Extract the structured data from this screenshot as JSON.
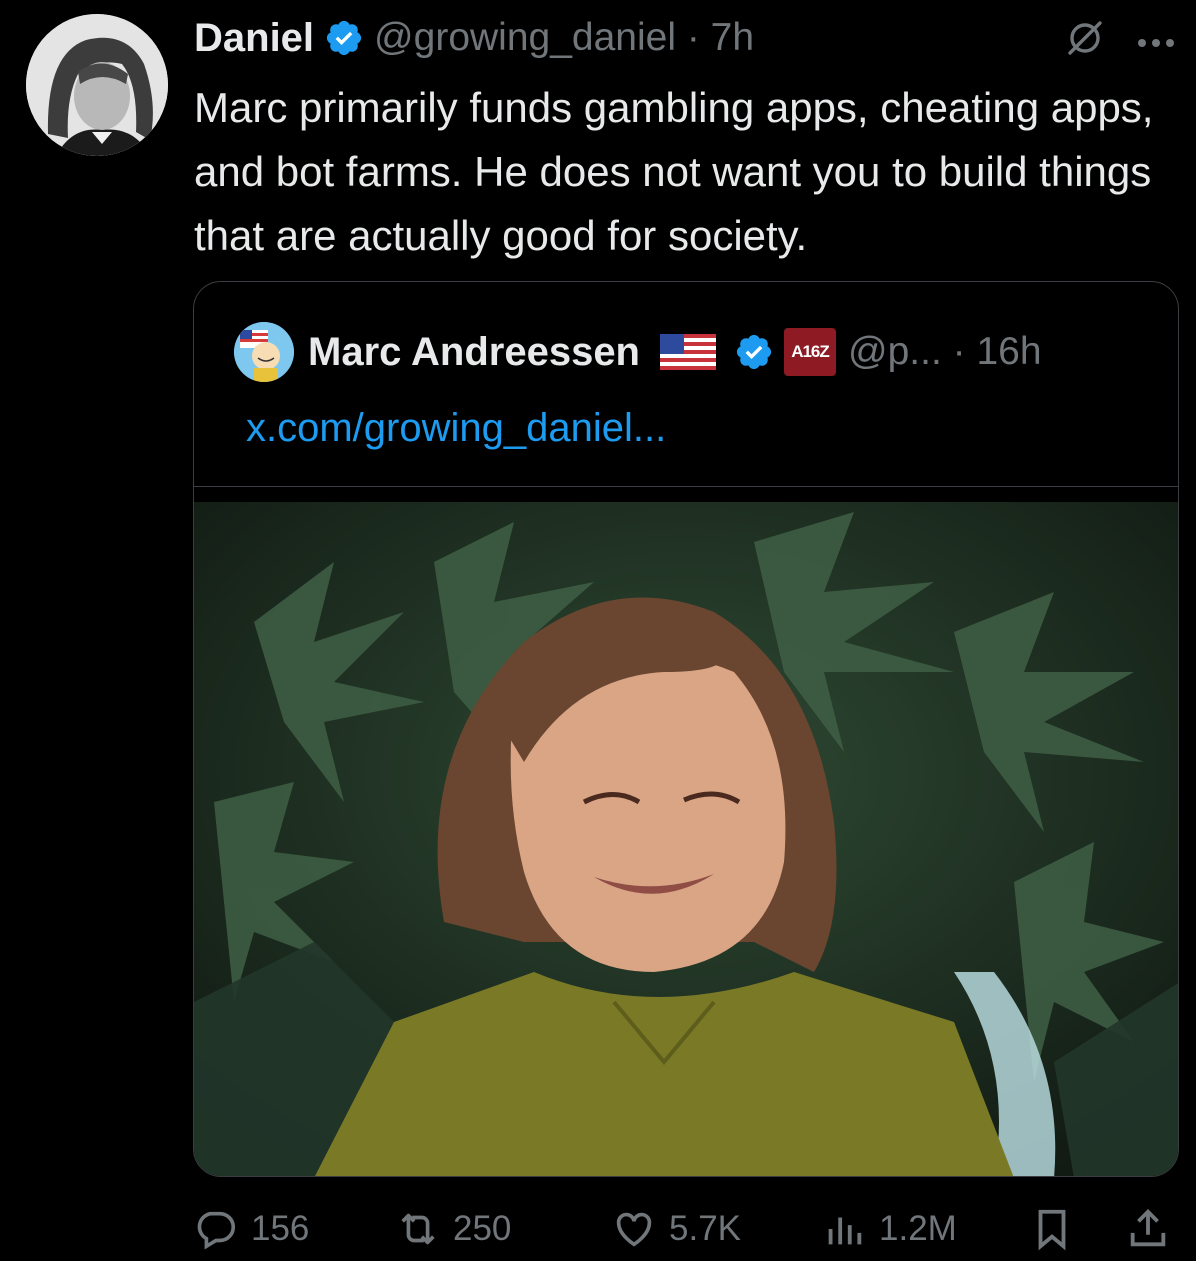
{
  "tweet": {
    "author_name": "Daniel",
    "handle_time": "@growing_daniel · 7h",
    "text": "Marc primarily funds gambling apps, cheating apps, and bot farms. He does not want you to build things that are actually good for society."
  },
  "quoted": {
    "author_name": "Marc Andreessen",
    "affiliate_badge": "A16Z",
    "handle_time": "@p... · 16h",
    "link_text": "x.com/growing_daniel..."
  },
  "actions": {
    "replies": "156",
    "reposts": "250",
    "likes": "5.7K",
    "views": "1.2M"
  },
  "colors": {
    "background": "#000000",
    "text": "#e7e9ea",
    "muted": "#71767b",
    "link": "#1d9bf0",
    "verified": "#1d9bf0",
    "border": "#3a3d41"
  }
}
